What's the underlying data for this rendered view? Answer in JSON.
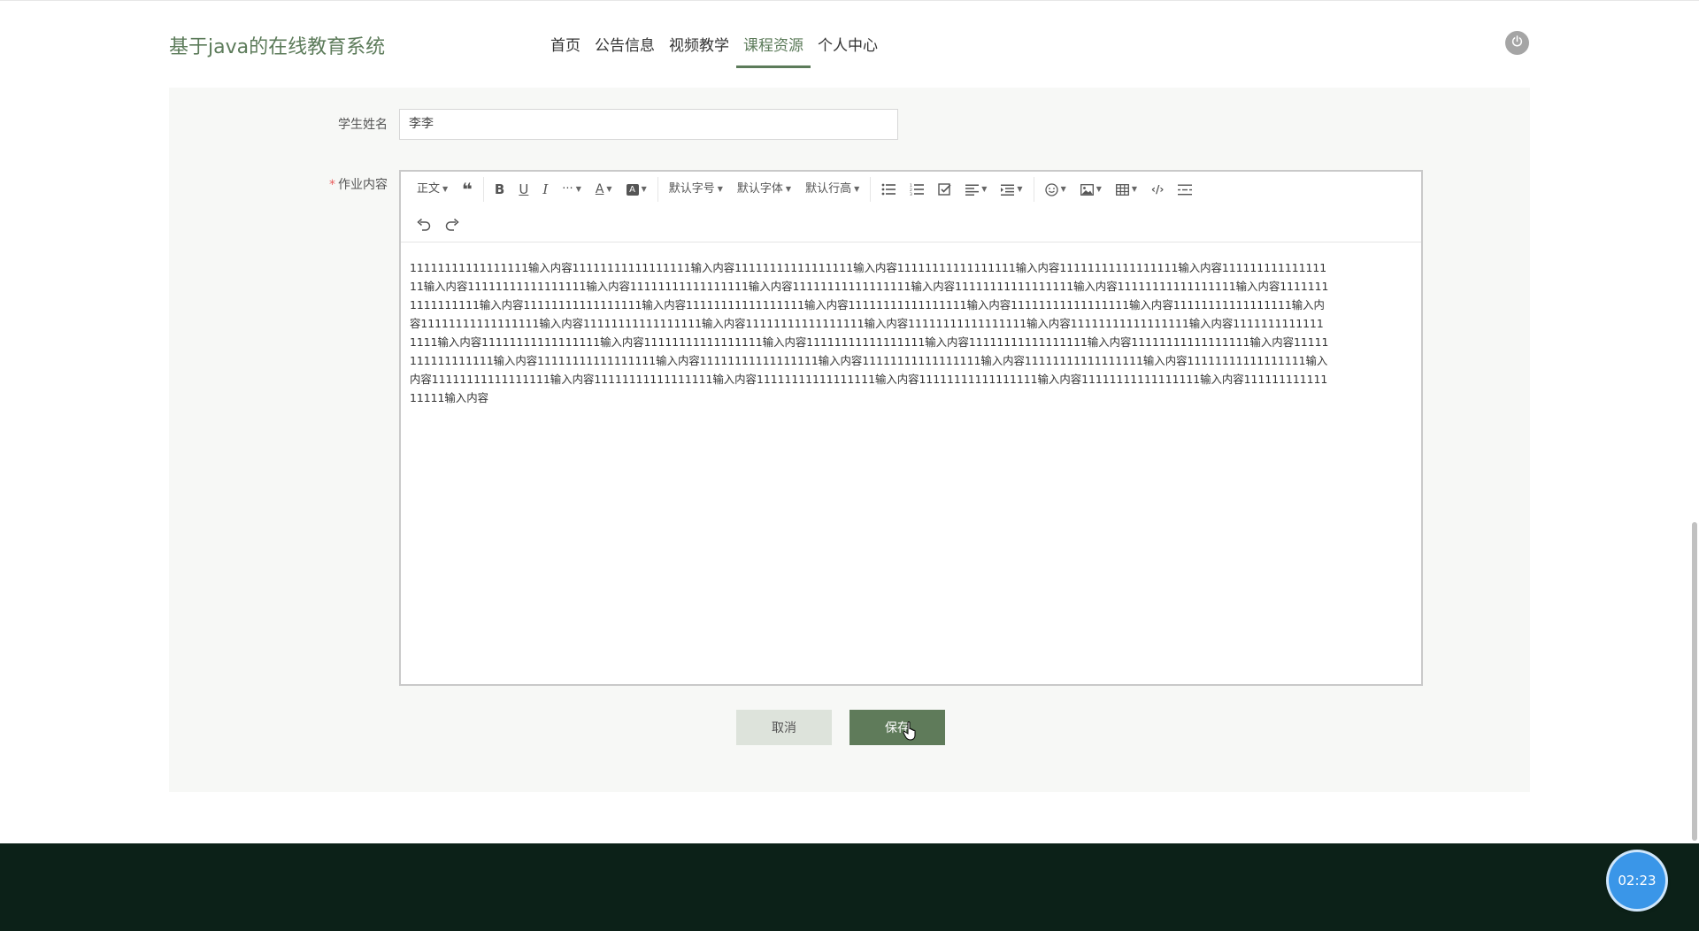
{
  "header": {
    "site_title": "基于java的在线教育系统",
    "nav": [
      {
        "label": "首页",
        "active": false
      },
      {
        "label": "公告信息",
        "active": false
      },
      {
        "label": "视频教学",
        "active": false
      },
      {
        "label": "课程资源",
        "active": true
      },
      {
        "label": "个人中心",
        "active": false
      }
    ]
  },
  "form": {
    "student_name_label": "学生姓名",
    "student_name_value": "李李",
    "required_mark": "*",
    "content_label": "作业内容"
  },
  "toolbar": {
    "heading_label": "正文",
    "font_size_label": "默认字号",
    "font_family_label": "默认字体",
    "line_height_label": "默认行高",
    "more_label": "···"
  },
  "editor": {
    "content": "11111111111111111输入内容11111111111111111输入内容11111111111111111输入内容11111111111111111输入内容11111111111111111输入内容11111111111111111输入内容11111111111111111输入内容11111111111111111输入内容11111111111111111输入内容11111111111111111输入内容11111111111111111输入内容11111111111111111输入内容11111111111111111输入内容11111111111111111输入内容11111111111111111输入内容11111111111111111输入内容11111111111111111输入内容11111111111111111输入内容11111111111111111输入内容11111111111111111输入内容11111111111111111输入内容11111111111111111输入内容11111111111111111输入内容11111111111111111输入内容11111111111111111输入内容11111111111111111输入内容11111111111111111输入内容11111111111111111输入内容11111111111111111输入内容11111111111111111输入内容11111111111111111输入内容11111111111111111输入内容11111111111111111输入内容11111111111111111输入内容11111111111111111输入内容11111111111111111输入内容11111111111111111输入内容11111111111111111输入内容11111111111111111输入内容11111111111111111输入内容"
  },
  "actions": {
    "cancel_label": "取消",
    "save_label": "保存"
  },
  "timer": {
    "value": "02:23"
  },
  "colors": {
    "brand": "#5c7b5a",
    "footer": "#0c2118",
    "timer": "#3a96e8"
  }
}
